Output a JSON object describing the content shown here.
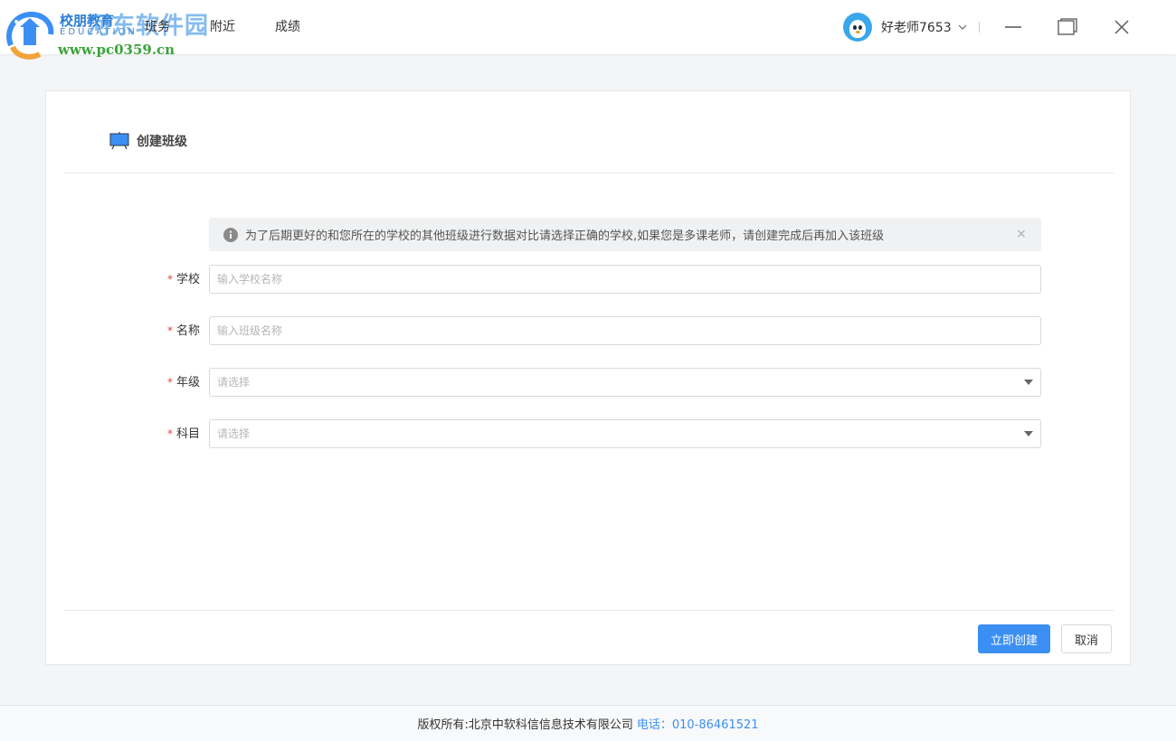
{
  "header": {
    "logo_text": "校朋教育",
    "logo_sub": "EDUCATION",
    "watermark_title": "河东软件园",
    "watermark_url": "www.pc0359.cn",
    "nav": [
      {
        "label": "班务"
      },
      {
        "label": "附近"
      },
      {
        "label": "成绩"
      }
    ],
    "user_name": "好老师7653",
    "colors": {
      "brand": "#2a7bd4",
      "watermark_green": "#3aa33a"
    }
  },
  "card": {
    "title": "创建班级",
    "notice": "为了后期更好的和您所在的学校的其他班级进行数据对比请选择正确的学校,如果您是多课老师，请创建完成后再加入该班级",
    "fields": {
      "school": {
        "label": "学校",
        "placeholder": "输入学校名称",
        "required": "*"
      },
      "name": {
        "label": "名称",
        "placeholder": "输入班级名称",
        "required": "*"
      },
      "grade": {
        "label": "年级",
        "selected": "请选择",
        "required": "*"
      },
      "subject": {
        "label": "科目",
        "selected": "请选择",
        "required": "*"
      }
    },
    "buttons": {
      "create": "立即创建",
      "cancel": "取消"
    },
    "colors": {
      "primary": "#3b8ff3",
      "required": "#e0443a"
    }
  },
  "footer": {
    "copyright": "版权所有:北京中软科信信息技术有限公司",
    "phone": "电话：010-86461521"
  }
}
